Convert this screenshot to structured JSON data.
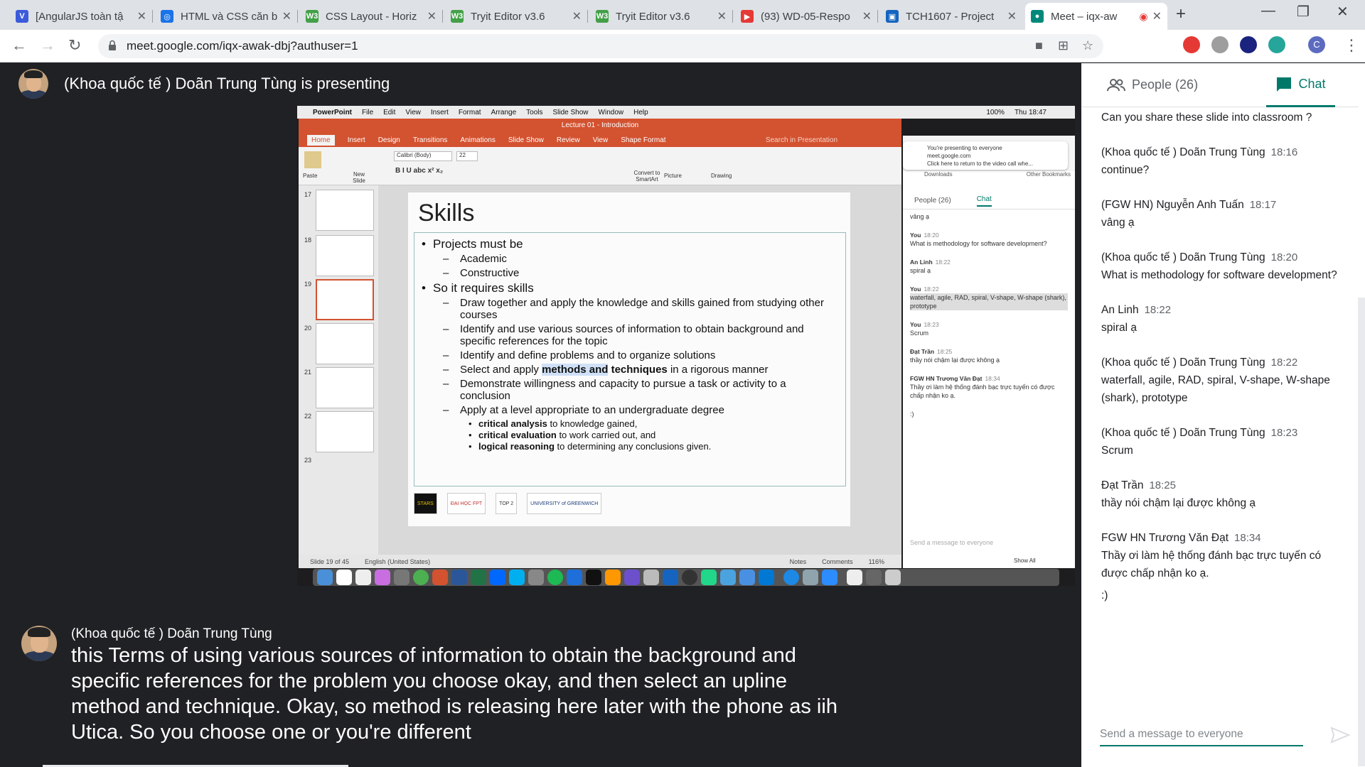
{
  "browser": {
    "tabs": [
      {
        "title": "[AngularJS toàn tậ",
        "color": "#3b5bdb",
        "glyph": "V"
      },
      {
        "title": "HTML và CSS căn b",
        "color": "#1a73e8",
        "glyph": "◎"
      },
      {
        "title": "CSS Layout - Horiz",
        "color": "#43a047",
        "glyph": "W3"
      },
      {
        "title": "Tryit Editor v3.6",
        "color": "#43a047",
        "glyph": "W3"
      },
      {
        "title": "Tryit Editor v3.6",
        "color": "#43a047",
        "glyph": "W3"
      },
      {
        "title": "(93) WD-05-Respo",
        "color": "#e53935",
        "glyph": "▶"
      },
      {
        "title": "TCH1607 - Project",
        "color": "#1565c0",
        "glyph": "▣"
      },
      {
        "title": "Meet – iqx-aw",
        "color": "#00897b",
        "glyph": "●"
      }
    ],
    "url": "meet.google.com/iqx-awak-dbj?authuser=1",
    "profile_initial": "C"
  },
  "meet": {
    "presenting_text": "(Khoa quốc tế ) Doãn Trung Tùng is presenting",
    "caption_speaker": "(Khoa quốc tế ) Doãn Trung Tùng",
    "caption_text": "this Terms of using various sources of information to obtain the background and specific references for the problem you choose okay, and then select an upline method and technique. Okay, so method is releasing here later with the phone as iih Utica. So you choose one or you're different",
    "people_tab": "People (26)",
    "chat_tab": "Chat",
    "chat_placeholder": "Send a message to everyone",
    "messages": [
      {
        "sender": "",
        "time": "",
        "text": "Can you share these slide into classroom ?"
      },
      {
        "sender": "(Khoa quốc tế ) Doãn Trung Tùng",
        "time": "18:16",
        "text": "continue?"
      },
      {
        "sender": "(FGW HN) Nguyễn Anh Tuấn",
        "time": "18:17",
        "text": "vâng ạ"
      },
      {
        "sender": "(Khoa quốc tế ) Doãn Trung Tùng",
        "time": "18:20",
        "text": "What is methodology for software development?"
      },
      {
        "sender": "An Linh",
        "time": "18:22",
        "text": "spiral ạ"
      },
      {
        "sender": "(Khoa quốc tế ) Doãn Trung Tùng",
        "time": "18:22",
        "text": "waterfall, agile, RAD, spiral, V-shape, W-shape (shark), prototype"
      },
      {
        "sender": "(Khoa quốc tế ) Doãn Trung Tùng",
        "time": "18:23",
        "text": "Scrum"
      },
      {
        "sender": "Đạt Trần",
        "time": "18:25",
        "text": "thầy nói chậm lại được không ạ"
      },
      {
        "sender": "FGW HN Trương Văn Đạt",
        "time": "18:34",
        "text": "Thầy ơi  làm hệ thống đánh bạc trực tuyến có được chấp nhận ko ạ."
      },
      {
        "sender": "",
        "time": "",
        "text": ":)"
      }
    ]
  },
  "shared_screen": {
    "mac_menu": [
      "PowerPoint",
      "File",
      "Edit",
      "View",
      "Insert",
      "Format",
      "Arrange",
      "Tools",
      "Slide Show",
      "Window",
      "Help"
    ],
    "mac_clock": "Thu 18:47",
    "mac_battery": "100%",
    "window_title": "Lecture 01 - Introduction",
    "ribbon_tabs": [
      "Home",
      "Insert",
      "Design",
      "Transitions",
      "Animations",
      "Slide Show",
      "Review",
      "View",
      "Shape Format"
    ],
    "search_placeholder": "Search in Presentation",
    "font_name": "Calibri (Body)",
    "font_size": "22",
    "ribbon_labels": {
      "paste": "Paste",
      "new_slide": "New Slide",
      "convert": "Convert to SmartArt",
      "picture": "Picture",
      "drawing": "Drawing"
    },
    "thumb_numbers": [
      "17",
      "18",
      "19",
      "20",
      "21",
      "22",
      "23"
    ],
    "slide_title": "Skills",
    "statusbar": {
      "slide_of": "Slide 19 of 45",
      "language": "English (United States)",
      "notes": "Notes",
      "comments": "Comments",
      "zoom": "116%"
    },
    "logos": [
      "STARS",
      "ĐẠI HỌC FPT",
      "TOP 2",
      "UNIVERSITY of GREENWICH"
    ],
    "inner_meet": {
      "notice_line1": "You're presenting to everyone",
      "notice_line2": "meet.google.com",
      "notice_line3": "Click here to return to the video call whe...",
      "bookmarks": "Downloads",
      "other_bookmarks": "Other Bookmarks",
      "people": "People (26)",
      "chat": "Chat",
      "messages": [
        {
          "name": "",
          "time": "",
          "text": "vâng ạ"
        },
        {
          "name": "You",
          "time": "18:20",
          "text": "What is methodology for software development?"
        },
        {
          "name": "An Linh",
          "time": "18:22",
          "text": "spiral ạ"
        },
        {
          "name": "You",
          "time": "18:22",
          "text": "waterfall, agile, RAD, spiral, V-shape, W-shape (shark), prototype"
        },
        {
          "name": "You",
          "time": "18:23",
          "text": "Scrum"
        },
        {
          "name": "Đạt Trần",
          "time": "18:25",
          "text": "thầy nói chậm lại được không ạ"
        },
        {
          "name": "FGW HN Trương Văn Đạt",
          "time": "18:34",
          "text": "Thầy ơi  làm hệ thống đánh bạc trực tuyến có được chấp nhận ko ạ."
        },
        {
          "name": "",
          "time": "",
          "text": ":)"
        }
      ],
      "send_placeholder": "Send a message to everyone",
      "show_all": "Show All"
    }
  },
  "slide_content": {
    "b1": "Projects must be",
    "b1_1": "Academic",
    "b1_2": "Constructive",
    "b2": "So it requires skills",
    "b2_1": "Draw together and apply the knowledge and skills gained from studying other courses",
    "b2_2": "Identify and use various sources of information to obtain background and specific references for the topic",
    "b2_3": "Identify and define problems and to organize solutions",
    "b2_4_pre": "Select and apply ",
    "b2_4_bold1": "methods and",
    "b2_4_bold2": " techniques",
    "b2_4_post": " in a rigorous manner",
    "b2_5": "Demonstrate willingness and capacity to pursue a task or activity to a conclusion",
    "b2_6": "Apply at a level appropriate to an undergraduate degree",
    "b3_1_bold": "critical analysis",
    "b3_1": " to knowledge gained,",
    "b3_2_bold": "critical evaluation",
    "b3_2": " to work carried out, and",
    "b3_3_bold": "logical reasoning",
    "b3_3": " to determining any conclusions given."
  },
  "colors": {
    "meet_accent": "#00796b",
    "powerpoint": "#d35230",
    "background": "#202124"
  }
}
